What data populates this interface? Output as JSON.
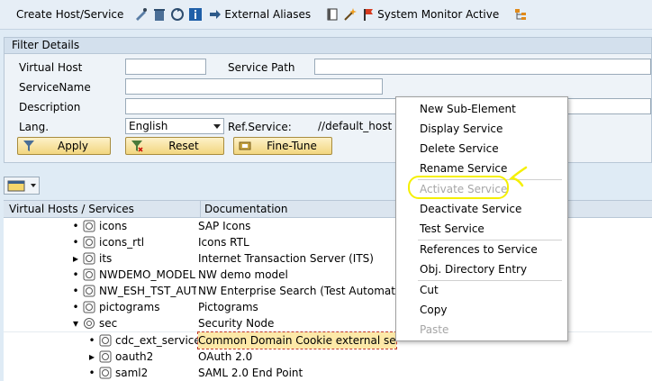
{
  "toolbar": {
    "create_label": "Create Host/Service",
    "external_aliases_label": "External Aliases",
    "system_monitor_label": "System Monitor Active"
  },
  "filter": {
    "header": "Filter Details",
    "virtual_host_label": "Virtual Host",
    "virtual_host_value": "",
    "service_path_label": "Service Path",
    "service_path_value": "",
    "service_name_label": "ServiceName",
    "service_name_value": "",
    "description_label": "Description",
    "description_value": "",
    "lang_label": "Lang.",
    "lang_value": "English",
    "ref_service_label": "Ref.Service:",
    "ref_service_value": "//default_host",
    "apply_label": "Apply",
    "reset_label": "Reset",
    "finetune_label": "Fine-Tune"
  },
  "tree": {
    "col_services": "Virtual Hosts / Services",
    "col_documentation": "Documentation",
    "rows": [
      {
        "name": "icons",
        "doc": "SAP Icons"
      },
      {
        "name": "icons_rtl",
        "doc": "Icons RTL"
      },
      {
        "name": "its",
        "doc": "Internet Transaction Server (ITS)"
      },
      {
        "name": "NWDEMO_MODEL",
        "doc": "NW demo model"
      },
      {
        "name": "NW_ESH_TST_AUT",
        "doc": "NW Enterprise Search (Test Automation"
      },
      {
        "name": "pictograms",
        "doc": "Pictograms"
      },
      {
        "name": "sec",
        "doc": "Security Node"
      },
      {
        "name": "cdc_ext_service",
        "doc": "Common Domain Cookie external service"
      },
      {
        "name": "oauth2",
        "doc": "OAuth 2.0"
      },
      {
        "name": "saml2",
        "doc": "SAML 2.0 End Point"
      }
    ]
  },
  "context_menu": {
    "items": [
      "New Sub-Element",
      "Display Service",
      "Delete Service",
      "Rename Service",
      "Activate Service",
      "Deactivate Service",
      "Test Service",
      "References to Service",
      "Obj. Directory Entry",
      "Cut",
      "Copy",
      "Paste"
    ]
  },
  "colors": {
    "background": "#dfebf5",
    "button_gold": "#f2d67f",
    "highlight_yellow": "#f5f000",
    "disabled_text": "#a6a6a6"
  }
}
